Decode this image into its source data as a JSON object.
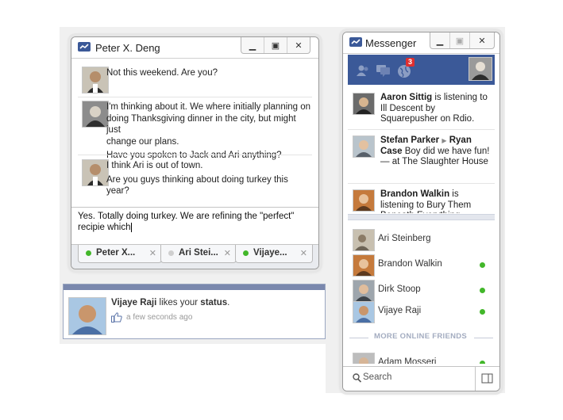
{
  "colors": {
    "online": "#42b72a",
    "brand": "#3b5998",
    "badge": "#e02f2f",
    "link": "#3b5998"
  },
  "chat": {
    "title": "Peter X. Deng",
    "window_icons": [
      "minimize-icon",
      "popout-icon",
      "close-icon"
    ],
    "messages": [
      {
        "lines": [
          "Not this weekend. Are you?"
        ]
      },
      {
        "lines": [
          "I'm thinking about it. We where initially planning on",
          "doing Thanksgiving dinner in the city, but might just",
          "change our plans.",
          "Have you spoken to Jack and Ari anything?"
        ]
      },
      {
        "lines": [
          "I think Ari is out of town.",
          "Are you guys thinking about doing turkey this year?"
        ]
      }
    ],
    "composer_text": "Yes. Totally doing turkey. We are refining the \"perfect\" recipie which",
    "tabs": [
      {
        "label": "Peter X...",
        "status": "online"
      },
      {
        "label": "Ari Stei...",
        "status": "idle"
      },
      {
        "label": "Vijaye...",
        "status": "online"
      }
    ]
  },
  "notification": {
    "actor": "Vijaye Raji",
    "verb": " likes your ",
    "object": "status",
    "end": ".",
    "time": "a few seconds ago"
  },
  "messenger": {
    "title": "Messenger",
    "badge_count": "3",
    "ticker": [
      {
        "actor": "Aaron Sittig",
        "text": " is listening to Ill Descent by Squarepusher on Rdio."
      },
      {
        "actor": "Stefan Parker",
        "arrow": "▶",
        "actor2": "Ryan Case",
        "text": " Boy did we have fun! — at The Slaughter House"
      },
      {
        "actor": "Brandon Walkin",
        "text": " is listening to Bury Them Beneath Everything"
      }
    ],
    "friends": [
      {
        "name": "Ari Steinberg",
        "online": false
      },
      {
        "name": "Brandon Walkin",
        "online": true
      },
      {
        "name": "Dirk Stoop",
        "online": true
      },
      {
        "name": "Vijaye Raji",
        "online": true
      }
    ],
    "more_label": "MORE ONLINE FRIENDS",
    "more_friends": [
      {
        "name": "Adam Mosseri",
        "online": true
      }
    ],
    "search_label": "Search"
  }
}
